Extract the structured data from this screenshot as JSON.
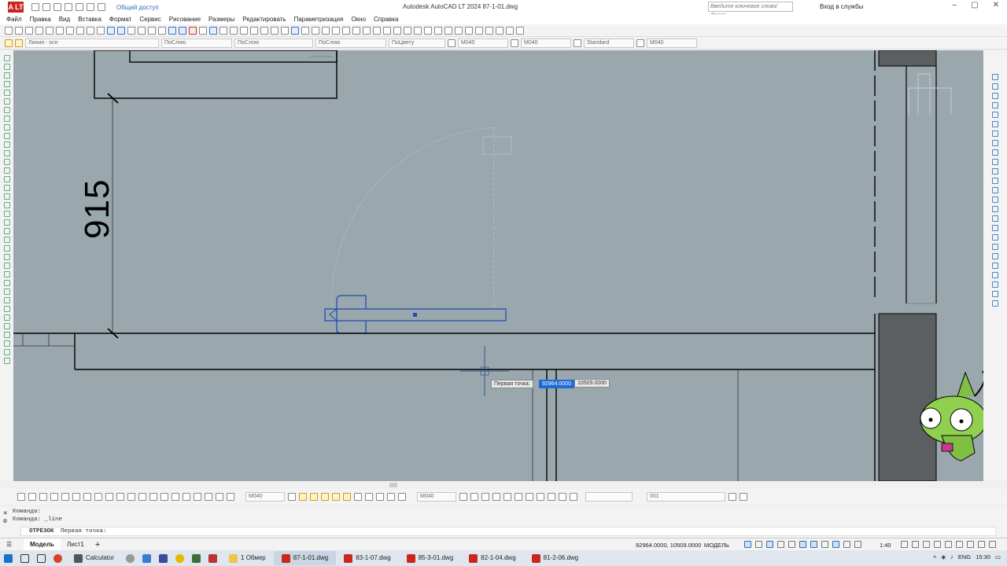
{
  "window": {
    "title": "Autodesk AutoCAD LT 2024    87-1-01.dwg",
    "share_label": "Общий доступ",
    "search_placeholder": "Введите ключевое слово/фразу",
    "signin_label": "Вход в службы",
    "logo_text": "A LT"
  },
  "menu": {
    "items": [
      "Файл",
      "Правка",
      "Вид",
      "Вставка",
      "Формат",
      "Сервис",
      "Рисование",
      "Размеры",
      "Редактировать",
      "Параметризация",
      "Окно",
      "Справка"
    ]
  },
  "properties_bar": {
    "layer": "Линия - осн",
    "color": "ПоСлою",
    "linetype": "ПоСлою",
    "lineweight": "ПоСлою",
    "plotstyle": "ПоЦвету",
    "textstyle": "М040",
    "dimstyle": "М040",
    "tablestyle": "Standard",
    "multileader": "М040"
  },
  "drawing": {
    "dimension_value": "915",
    "prompt_label": "Первая точка:",
    "x_value": "92964.0000",
    "y_value": "10509.0000"
  },
  "bottom_toolbar": {
    "dimstyle": "М040",
    "textstyle": "М040",
    "layer2": "001"
  },
  "command": {
    "line1": "Команда:",
    "line2": "Команда: _line",
    "input_prefix": "ОТРЕЗОК",
    "input_text": "Первая точка:"
  },
  "status": {
    "tabs": [
      "Модель",
      "Лист1"
    ],
    "coords": "92964.0000, 10509.0000",
    "model_label": "МОДЕЛЬ",
    "scale": "1:40"
  },
  "taskbar": {
    "items": [
      "Calculator",
      "1 Обмер",
      "87-1-01.dwg",
      "83-1-07.dwg",
      "85-3-01.dwg",
      "82-1-04.dwg",
      "81-2-06.dwg"
    ],
    "lang": "ENG",
    "time": "15:30"
  },
  "colors": {
    "canvas_bg": "#9aa7ad",
    "selection_blue": "#1e4fb0",
    "mascot_green": "#8fd14f"
  }
}
